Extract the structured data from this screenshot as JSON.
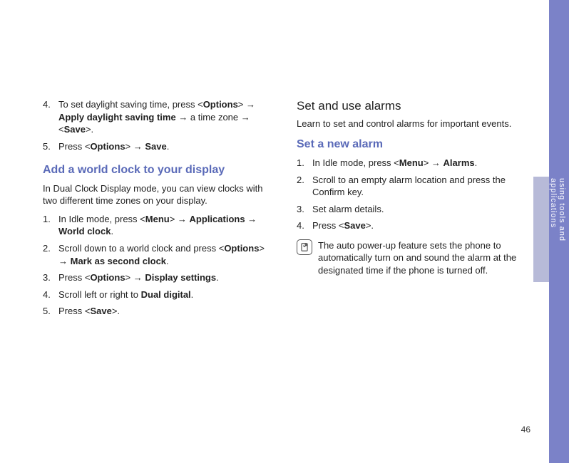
{
  "sideLabel": "using tools and applications",
  "pageNumber": "46",
  "left": {
    "listA": [
      {
        "n": "4.",
        "pre": "To set daylight saving time, press <",
        "k1": "Options",
        "mid1": "> → ",
        "k2": "Apply daylight saving time",
        "mid2": " → a time zone → <",
        "k3": "Save",
        "post": ">."
      },
      {
        "n": "5.",
        "pre": "Press <",
        "k1": "Options",
        "mid1": "> → ",
        "k2": "Save",
        "post": "."
      }
    ],
    "headingB": "Add a world clock to your display",
    "paraB": "In Dual Clock Display mode, you can view clocks with two different time zones on your display.",
    "listB": [
      {
        "n": "1.",
        "pre": "In Idle mode, press <",
        "k1": "Menu",
        "mid1": "> → ",
        "k2": "Applications",
        "mid2": " → ",
        "k3": "World clock",
        "post": "."
      },
      {
        "n": "2.",
        "pre": "Scroll down to a world clock and press <",
        "k1": "Options",
        "mid1": "> → ",
        "k2": "Mark as second clock",
        "post": "."
      },
      {
        "n": "3.",
        "pre": "Press <",
        "k1": "Options",
        "mid1": "> → ",
        "k2": "Display settings",
        "post": "."
      },
      {
        "n": "4.",
        "pre": "Scroll left or right to ",
        "k1": "Dual digital",
        "post": "."
      },
      {
        "n": "5.",
        "pre": "Press <",
        "k1": "Save",
        "post": ">."
      }
    ]
  },
  "right": {
    "headingA": "Set and use alarms",
    "subA": "Learn to set and control alarms for important events.",
    "headingB": "Set a new alarm",
    "listB": [
      {
        "n": "1.",
        "pre": "In Idle mode, press <",
        "k1": "Menu",
        "mid1": "> → ",
        "k2": "Alarms",
        "post": "."
      },
      {
        "n": "2.",
        "pre": "Scroll to an empty alarm location and press the Confirm key."
      },
      {
        "n": "3.",
        "pre": "Set alarm details."
      },
      {
        "n": "4.",
        "pre": "Press <",
        "k1": "Save",
        "post": ">."
      }
    ],
    "note": "The auto power-up feature sets the phone to automatically turn on and sound the alarm at the designated time if the phone is turned off."
  }
}
